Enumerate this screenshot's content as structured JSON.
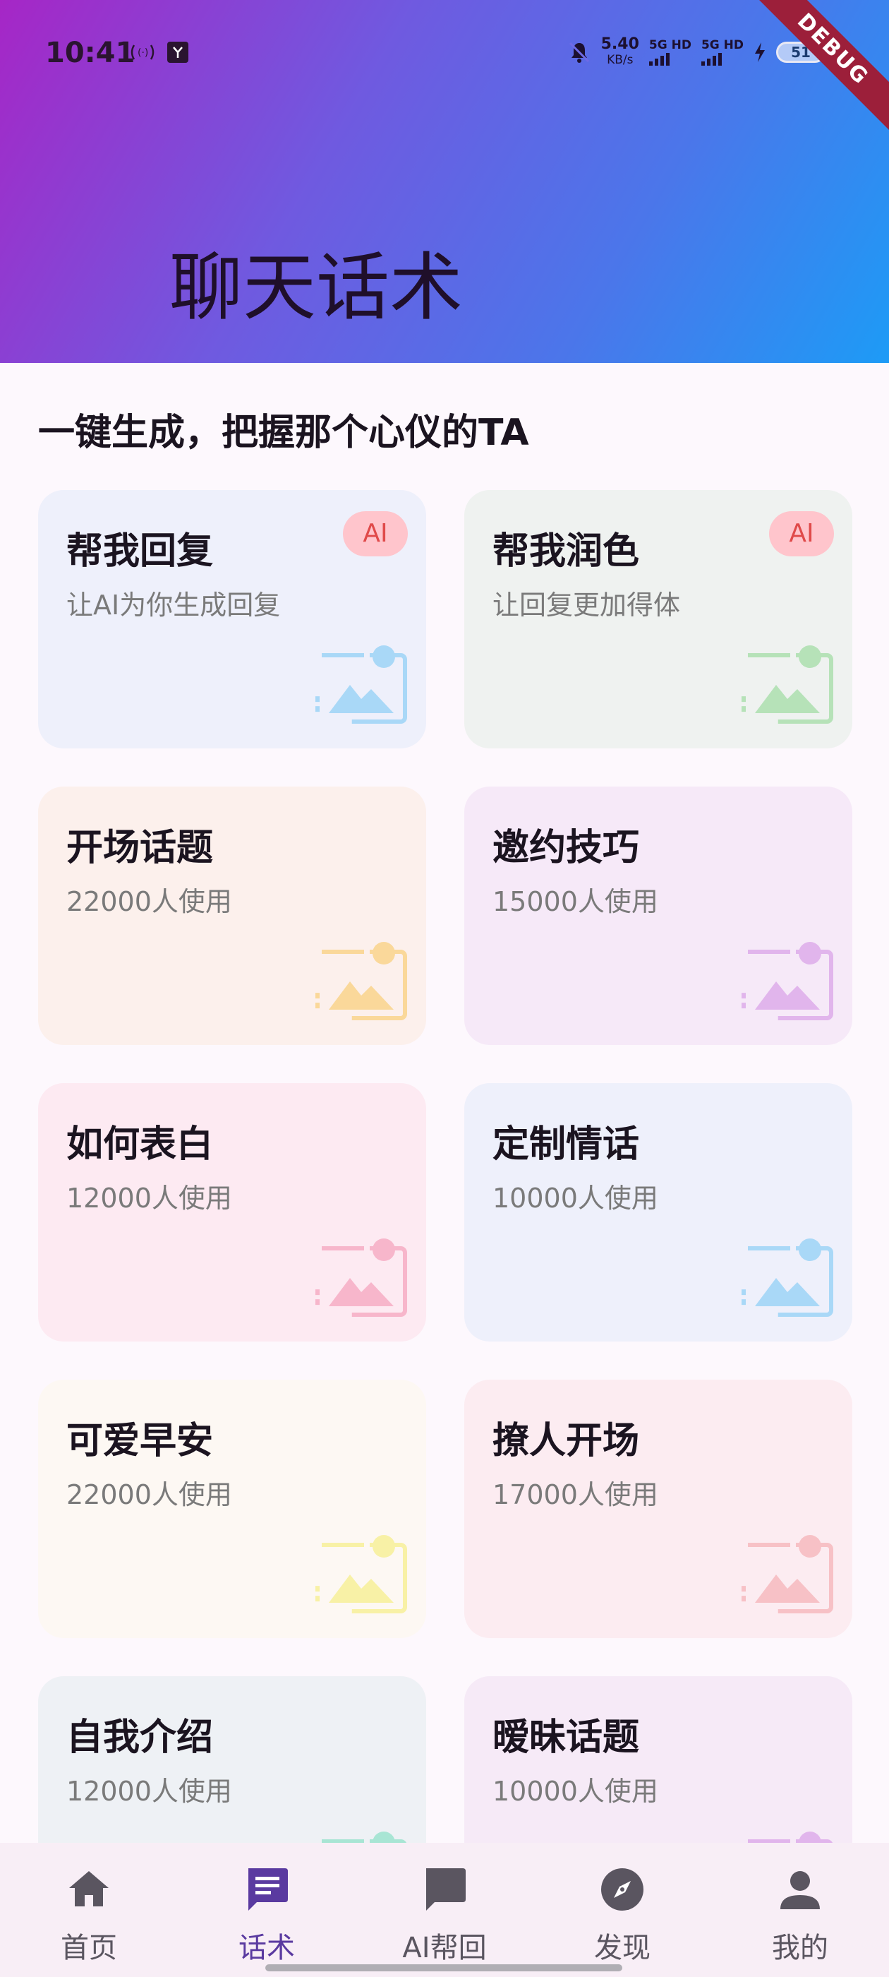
{
  "status_bar": {
    "time": "10:41",
    "net_speed_value": "5.40",
    "net_speed_unit": "KB/s",
    "sig1": "5G HD",
    "sig2": "5G HD",
    "battery": "51",
    "debug": "DEBUG"
  },
  "header": {
    "title": "聊天话术"
  },
  "section": {
    "title": "一键生成，把握那个心仪的TA"
  },
  "cards": [
    {
      "title": "帮我回复",
      "sub": "让AI为你生成回复",
      "badge": "AI",
      "bg": "#eef0fb",
      "icon_color": "#a9d8f7"
    },
    {
      "title": "帮我润色",
      "sub": "让回复更加得体",
      "badge": "AI",
      "bg": "#eff2f0",
      "icon_color": "#b6e2b8"
    },
    {
      "title": "开场话题",
      "sub": "22000人使用",
      "bg": "#fcf0ec",
      "icon_color": "#fad89a"
    },
    {
      "title": "邀约技巧",
      "sub": "15000人使用",
      "bg": "#f6e9f8",
      "icon_color": "#e1b5ec"
    },
    {
      "title": "如何表白",
      "sub": "12000人使用",
      "bg": "#fdeaf2",
      "icon_color": "#f7b6cb"
    },
    {
      "title": "定制情话",
      "sub": "10000人使用",
      "bg": "#eef0fb",
      "icon_color": "#a9d8f7"
    },
    {
      "title": "可爱早安",
      "sub": "22000人使用",
      "bg": "#fdf8f3",
      "icon_color": "#f8f1a6"
    },
    {
      "title": "撩人开场",
      "sub": "17000人使用",
      "bg": "#fcecf1",
      "icon_color": "#f7c1c6"
    },
    {
      "title": "自我介绍",
      "sub": "12000人使用",
      "bg": "#eef1f5",
      "icon_color": "#a8e5d4"
    },
    {
      "title": "暧昧话题",
      "sub": "10000人使用",
      "bg": "#f6eaf7",
      "icon_color": "#e1b5ec"
    }
  ],
  "nav": {
    "home": "首页",
    "huashu": "话术",
    "aihelp": "AI帮回",
    "discover": "发现",
    "mine": "我的"
  },
  "colors": {
    "nav_active": "#5a3aa0",
    "nav_inactive": "#5a5560"
  }
}
